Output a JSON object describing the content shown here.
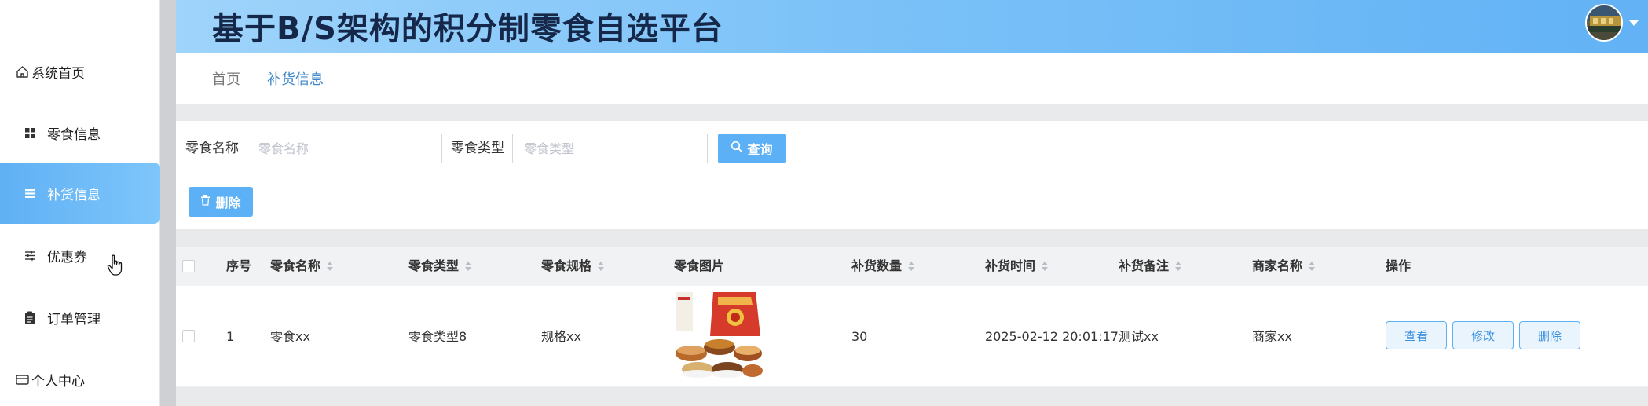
{
  "app": {
    "title": "基于B/S架构的积分制零食自选平台"
  },
  "sidebar": {
    "items": [
      {
        "label": "系统首页",
        "icon": "home-icon"
      },
      {
        "label": "零食信息",
        "icon": "grid-icon"
      },
      {
        "label": "补货信息",
        "icon": "list-icon",
        "active": true
      },
      {
        "label": "优惠券",
        "icon": "sliders-icon"
      },
      {
        "label": "订单管理",
        "icon": "clipboard-icon"
      },
      {
        "label": "个人中心",
        "icon": "card-icon"
      }
    ]
  },
  "breadcrumb": {
    "home": "首页",
    "current": "补货信息"
  },
  "search": {
    "name_label": "零食名称",
    "name_placeholder": "零食名称",
    "name_value": "",
    "type_label": "零食类型",
    "type_placeholder": "零食类型",
    "type_value": "",
    "query_label": "查询",
    "delete_label": "删除"
  },
  "table": {
    "columns": [
      "序号",
      "零食名称",
      "零食类型",
      "零食规格",
      "零食图片",
      "补货数量",
      "补货时间",
      "补货备注",
      "商家名称",
      "操作"
    ],
    "rows": [
      {
        "index": "1",
        "name": "零食xx",
        "type": "零食类型8",
        "spec": "规格xx",
        "quantity": "30",
        "time": "2025-02-12 20:01:17",
        "note": "测试xx",
        "merchant": "商家xx",
        "actions": {
          "view": "查看",
          "edit": "修改",
          "delete": "删除"
        }
      }
    ]
  },
  "colors": {
    "accent": "#5bb0f6",
    "header_gradient_start": "#9fd4fb",
    "header_gradient_end": "#62b2f5",
    "title_text": "#16284a",
    "breadcrumb_active": "#3d86c8"
  }
}
